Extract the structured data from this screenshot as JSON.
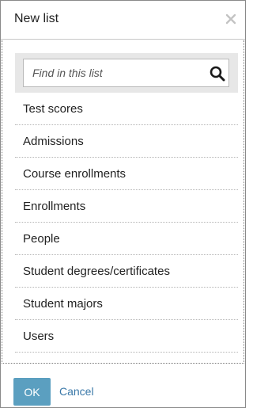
{
  "dialog": {
    "title": "New list",
    "close_icon": "close-icon"
  },
  "search": {
    "placeholder": "Find in this list",
    "value": "",
    "icon": "search-icon"
  },
  "list": {
    "items": [
      "Test scores",
      "Admissions",
      "Course enrollments",
      "Enrollments",
      "People",
      "Student degrees/certificates",
      "Student majors",
      "Users"
    ]
  },
  "footer": {
    "ok_label": "OK",
    "cancel_label": "Cancel"
  },
  "colors": {
    "accent": "#5b9fc0",
    "link": "#3a78a8",
    "search_bar_bg": "#e7e7e7"
  }
}
